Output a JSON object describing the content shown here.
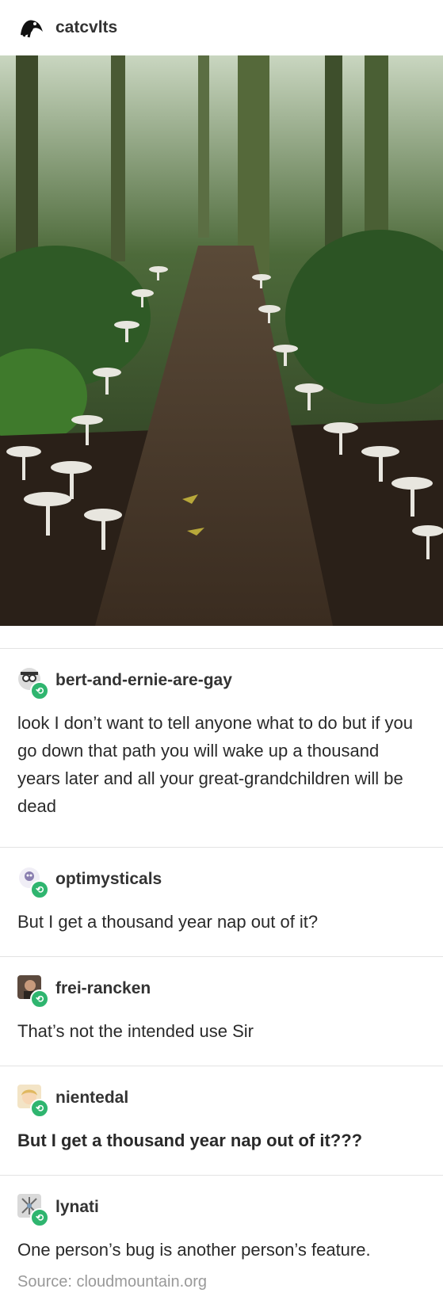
{
  "post": {
    "author": "catcvlts",
    "image_alt": "forest path lined with white mushrooms"
  },
  "reblogs": [
    {
      "username": "bert-and-ernie-are-gay",
      "text": "look I don’t want to tell anyone what to do but if you go down that path you will wake up a thousand years later and all your great-grandchildren will be dead",
      "bold": false
    },
    {
      "username": "optimysticals",
      "text": "But I get a thousand year nap out of it?",
      "bold": false
    },
    {
      "username": "frei-rancken",
      "text": "That’s not the intended use Sir",
      "bold": false
    },
    {
      "username": "nientedal",
      "text": "But I get a thousand year nap out of it???",
      "bold": true
    },
    {
      "username": "lynati",
      "text": "One person’s bug is another person’s feature.",
      "bold": false
    }
  ],
  "source": "Source: cloudmountain.org",
  "colors": {
    "reblog_badge": "#2fb56f",
    "divider": "#e3e3e3",
    "source_text": "#999999"
  }
}
